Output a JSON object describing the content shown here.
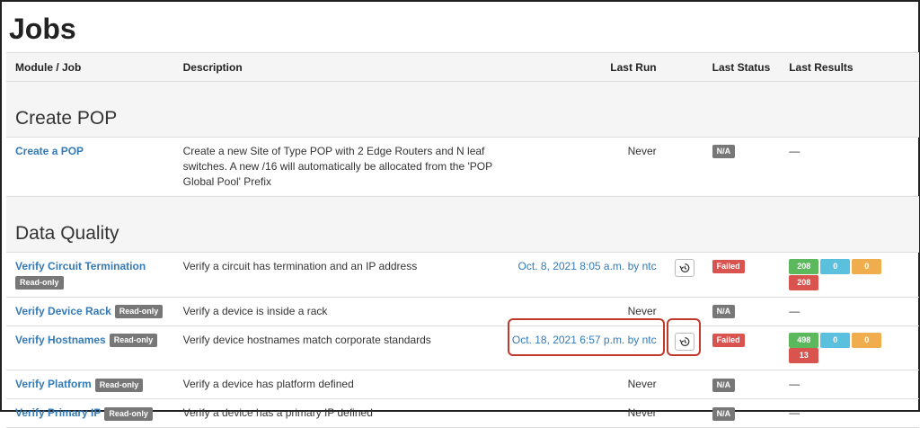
{
  "page": {
    "title": "Jobs"
  },
  "headers": {
    "module_job": "Module / Job",
    "description": "Description",
    "last_run": "Last Run",
    "last_status": "Last Status",
    "last_results": "Last Results"
  },
  "groups": [
    {
      "name": "Create POP",
      "jobs": [
        {
          "name": "Create a POP",
          "readonly": "",
          "description": "Create a new Site of Type POP with 2 Edge Routers and N leaf switches. A new /16 will automatically be allocated from the 'POP Global Pool' Prefix",
          "last_run": "Never",
          "status": "N/A",
          "results": "—"
        }
      ]
    },
    {
      "name": "Data Quality",
      "jobs": [
        {
          "name": "Verify Circuit Termination",
          "readonly": "Read-only",
          "description": "Verify a circuit has termination and an IP address",
          "last_run": "Oct. 8, 2021 8:05 a.m. by ntc",
          "status": "Failed",
          "results": [
            "208",
            "0",
            "0",
            "208"
          ]
        },
        {
          "name": "Verify Device Rack",
          "readonly": "Read-only",
          "description": "Verify a device is inside a rack",
          "last_run": "Never",
          "status": "N/A",
          "results": "—"
        },
        {
          "name": "Verify Hostnames",
          "readonly": "Read-only",
          "description": "Verify device hostnames match corporate standards",
          "last_run": "Oct. 18, 2021 6:57 p.m. by ntc",
          "status": "Failed",
          "results": [
            "498",
            "0",
            "0",
            "13"
          ]
        },
        {
          "name": "Verify Platform",
          "readonly": "Read-only",
          "description": "Verify a device has platform defined",
          "last_run": "Never",
          "status": "N/A",
          "results": "—"
        },
        {
          "name": "Verify Primary IP",
          "readonly": "Read-only",
          "description": "Verify a device has a primary IP defined",
          "last_run": "Never",
          "status": "N/A",
          "results": "—"
        }
      ]
    }
  ],
  "colors": {
    "link": "#337ab7",
    "success": "#5cb85c",
    "info": "#5bc0de",
    "warning": "#f0ad4e",
    "danger": "#d9534f",
    "default": "#777777",
    "highlight": "#c0392b"
  },
  "icons": {
    "history": "history-icon"
  }
}
